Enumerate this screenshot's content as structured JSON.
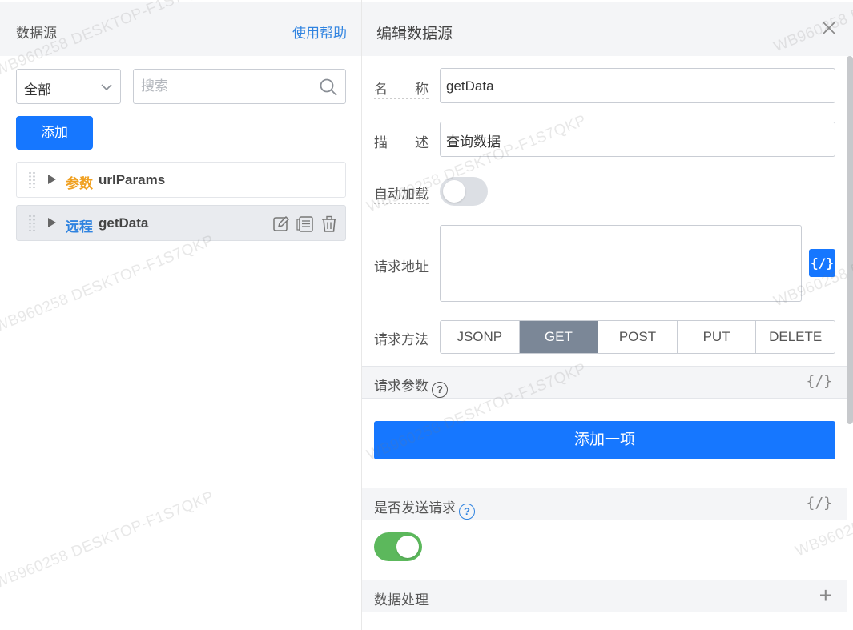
{
  "left_panel": {
    "title": "数据源",
    "help_link": "使用帮助",
    "filter_select": {
      "value": "全部"
    },
    "search": {
      "placeholder": "搜索",
      "value": ""
    },
    "add_button": "添加",
    "items": [
      {
        "tag": "参数",
        "name": "urlParams",
        "active": false
      },
      {
        "tag": "远程",
        "name": "getData",
        "active": true
      }
    ]
  },
  "right_panel": {
    "title": "编辑数据源",
    "name_label": "名　　称",
    "name_value": "getData",
    "desc_label": "描　　述",
    "desc_value": "查询数据",
    "autoload_label": "自动加载",
    "autoload_on": false,
    "url_label": "请求地址",
    "url_value": "",
    "code_button": "{/}",
    "method_label": "请求方法",
    "methods": [
      "JSONP",
      "GET",
      "POST",
      "PUT",
      "DELETE"
    ],
    "selected_method": "GET",
    "params_section": {
      "title": "请求参数",
      "code": "{/}"
    },
    "add_item_button": "添加一项",
    "send_section": {
      "title": "是否发送请求",
      "code": "{/}"
    },
    "send_on": true,
    "data_process_section": {
      "title": "数据处理",
      "plus": "+"
    }
  },
  "watermark": "WB960258 DESKTOP-F1S7QKP",
  "colors": {
    "primary": "#1677ff",
    "param_tag": "#f0a020",
    "remote_tag": "#2f83e0",
    "toggle_on": "#5cb85c",
    "method_selected": "#7b8797"
  }
}
